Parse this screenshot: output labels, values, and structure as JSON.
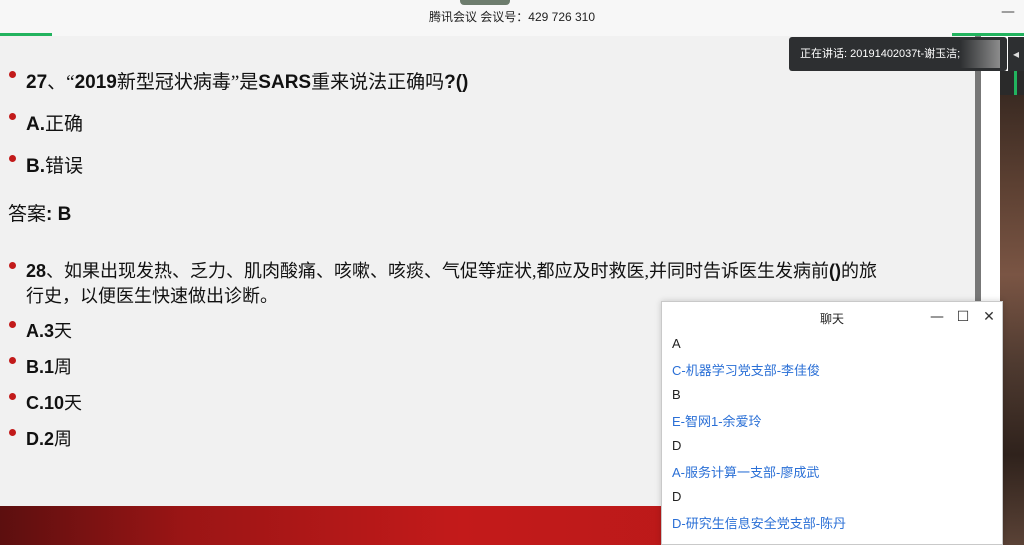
{
  "meeting": {
    "title": "腾讯会议 会议号：429 726 310"
  },
  "speaker": {
    "label": "正在讲话: 20191402037t-谢玉洁;"
  },
  "slide": {
    "q27": {
      "num": "27",
      "text_a": "、“",
      "year": "2019",
      "text_b": "新型冠状病毒”是",
      "sars": "SARS",
      "text_c": "重来说法正确吗",
      "tail": "?()"
    },
    "q27_options": [
      {
        "letter": "A.",
        "text": "正确"
      },
      {
        "letter": "B.",
        "text": "错误"
      }
    ],
    "answer": {
      "label": "答案",
      "value": ": B"
    },
    "q28": {
      "num": "28",
      "line1": "、如果出现发热、乏力、肌肉酸痛、咳嗽、咳痰、气促等症状,都应及时救医,并同时告诉医生发病前",
      "paren": "()",
      "line1_end": "的旅",
      "line2": "行史，以便医生快速做出诊断。"
    },
    "q28_options": [
      {
        "letter": "A.",
        "num": "3",
        "text": "天"
      },
      {
        "letter": "B.",
        "num": "1",
        "text": "周"
      },
      {
        "letter": "C.",
        "num": "10",
        "text": "天"
      },
      {
        "letter": "D.",
        "num": "2",
        "text": "周"
      }
    ]
  },
  "chat": {
    "title": "聊天",
    "messages": [
      {
        "text": "A",
        "sender": "C-机器学习党支部-李佳俊"
      },
      {
        "text": "B",
        "sender": "E-智网1-余爱玲"
      },
      {
        "text": "D",
        "sender": "A-服务计算一支部-廖成武"
      },
      {
        "text": "D",
        "sender": "D-研究生信息安全党支部-陈丹"
      }
    ]
  },
  "icons": {
    "minimize": "minimize-icon",
    "maximize": "maximize-icon",
    "close": "close-icon",
    "arrow": "arrow-left-icon"
  },
  "colors": {
    "bullet": "#c21a1a",
    "sender": "#2a6fd6",
    "accent_green": "#22b35e"
  }
}
